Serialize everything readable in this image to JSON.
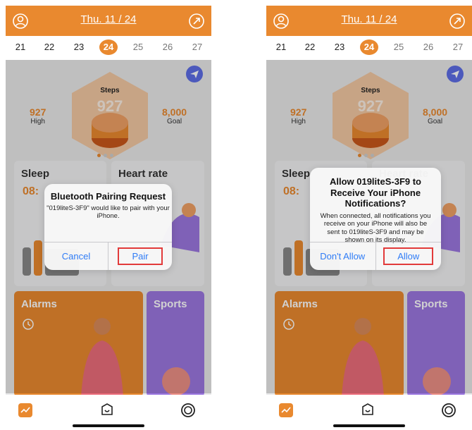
{
  "header": {
    "date_title": "Thu. 11 / 24"
  },
  "days": [
    "21",
    "22",
    "23",
    "24",
    "25",
    "26",
    "27"
  ],
  "steps": {
    "label": "Steps",
    "value": "927"
  },
  "stats": {
    "high_value": "927",
    "high_label": "High",
    "goal_value": "8,000",
    "goal_label": "Goal"
  },
  "cards": {
    "sleep_title": "Sleep",
    "sleep_time": "08:",
    "heart_title": "Heart rate",
    "alarms_title": "Alarms",
    "sports_title": "Sports"
  },
  "dialog_left": {
    "title": "Bluetooth Pairing Request",
    "message": "\"019liteS-3F9\" would like to pair with your iPhone.",
    "cancel_label": "Cancel",
    "confirm_label": "Pair"
  },
  "dialog_right": {
    "title": "Allow 019liteS-3F9 to Receive Your iPhone Notifications?",
    "message": "When connected, all notifications you receive on your iPhone will also be sent to 019liteS-3F9 and may be shown on its display.",
    "deny_label": "Don't Allow",
    "allow_label": "Allow"
  },
  "colors": {
    "accent": "#e9892f",
    "sports": "#9b77e0",
    "link": "#2f7cf6",
    "highlight": "#e23a3a"
  }
}
